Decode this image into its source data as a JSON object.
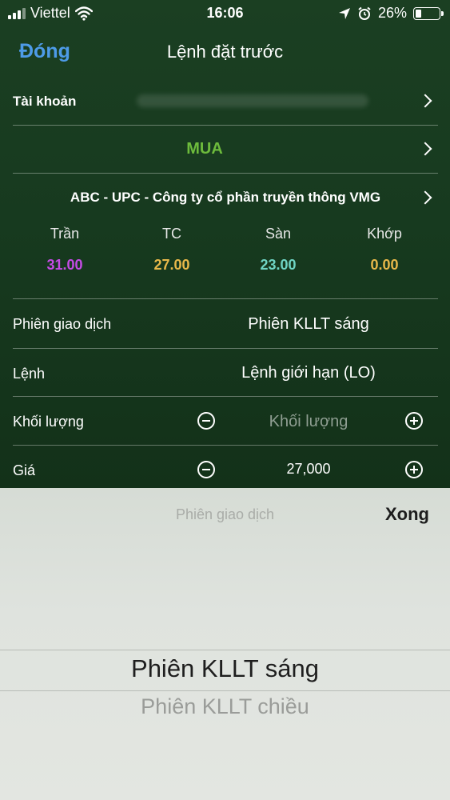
{
  "status_bar": {
    "carrier": "Viettel",
    "time": "16:06",
    "battery_percent": "26%",
    "battery_level": 0.26,
    "icons": [
      "signal-icon",
      "wifi-icon",
      "location-arrow-icon",
      "alarm-icon",
      "battery-icon"
    ]
  },
  "nav": {
    "close_label": "Đóng",
    "title": "Lệnh đặt trước"
  },
  "account": {
    "label": "Tài khoản"
  },
  "side": {
    "label": "MUA",
    "color": "#6dbb3c"
  },
  "stock": {
    "label": "ABC - UPC - Công ty cổ phần truyền thông VMG"
  },
  "prices": {
    "ceiling": {
      "label": "Trần",
      "value": "31.00",
      "color": "#c54be6"
    },
    "reference": {
      "label": "TC",
      "value": "27.00",
      "color": "#e8b84a"
    },
    "floor": {
      "label": "Sàn",
      "value": "23.00",
      "color": "#6fd4c4"
    },
    "matched": {
      "label": "Khớp",
      "value": "0.00",
      "color": "#e8b84a"
    }
  },
  "form": {
    "session": {
      "label": "Phiên giao dịch",
      "value": "Phiên KLLT sáng"
    },
    "order_type": {
      "label": "Lệnh",
      "value": "Lệnh giới hạn (LO)"
    },
    "quantity": {
      "label": "Khối lượng",
      "placeholder": "Khối lượng"
    },
    "price": {
      "label": "Giá",
      "value": "27,000"
    }
  },
  "picker": {
    "title": "Phiên giao dịch",
    "done_label": "Xong",
    "options": [
      "Phiên KLLT sáng",
      "Phiên KLLT chiều"
    ],
    "selected": "Phiên KLLT sáng"
  }
}
